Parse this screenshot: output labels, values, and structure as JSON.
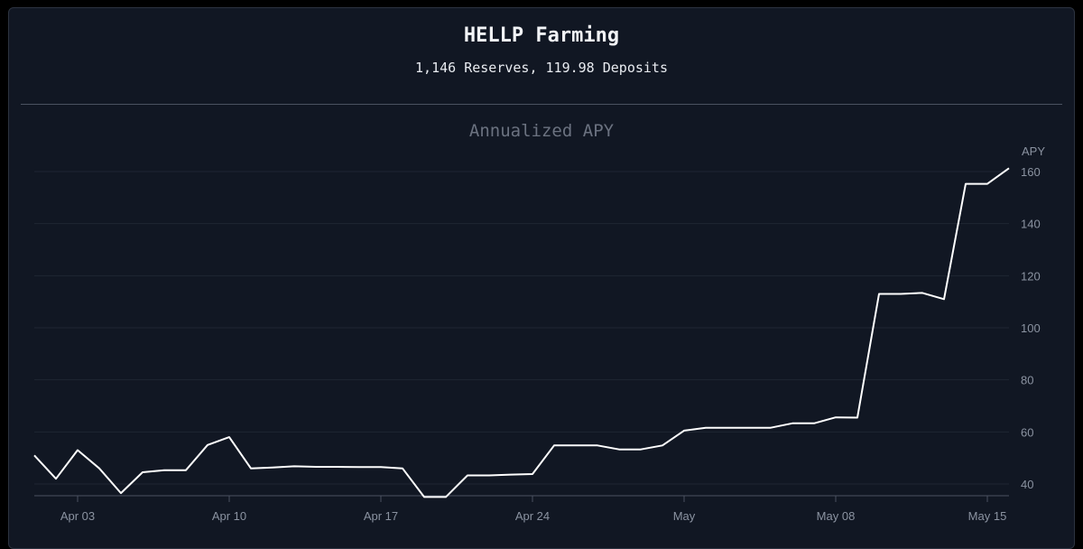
{
  "header": {
    "title": "HELLP Farming",
    "subtitle": "1,146 Reserves, 119.98 Deposits"
  },
  "chart_data": {
    "type": "line",
    "title": "Annualized APY",
    "ylabel": "APY",
    "xlabel": "",
    "ylim": [
      35,
      162
    ],
    "y_ticks": [
      40,
      60,
      80,
      100,
      120,
      140,
      160
    ],
    "x_ticks": [
      {
        "label": "Apr 03",
        "date": "2023-04-03"
      },
      {
        "label": "Apr 10",
        "date": "2023-04-10"
      },
      {
        "label": "Apr 17",
        "date": "2023-04-17"
      },
      {
        "label": "Apr 24",
        "date": "2023-04-24"
      },
      {
        "label": "May",
        "date": "2023-05-01"
      },
      {
        "label": "May 08",
        "date": "2023-05-08"
      },
      {
        "label": "May 15",
        "date": "2023-05-15"
      }
    ],
    "grid": true,
    "line_color": "#ffffff",
    "series": [
      {
        "points": [
          [
            "2023-04-01",
            51
          ],
          [
            "2023-04-02",
            42
          ],
          [
            "2023-04-03",
            53
          ],
          [
            "2023-04-04",
            46
          ],
          [
            "2023-04-05",
            36.5
          ],
          [
            "2023-04-06",
            44.5
          ],
          [
            "2023-04-07",
            45.3
          ],
          [
            "2023-04-08",
            45.3
          ],
          [
            "2023-04-09",
            55
          ],
          [
            "2023-04-10",
            58
          ],
          [
            "2023-04-11",
            46
          ],
          [
            "2023-04-12",
            46.3
          ],
          [
            "2023-04-13",
            46.8
          ],
          [
            "2023-04-14",
            46.6
          ],
          [
            "2023-04-15",
            46.6
          ],
          [
            "2023-04-16",
            46.5
          ],
          [
            "2023-04-17",
            46.5
          ],
          [
            "2023-04-18",
            46
          ],
          [
            "2023-04-19",
            35
          ],
          [
            "2023-04-20",
            35
          ],
          [
            "2023-04-21",
            43.3
          ],
          [
            "2023-04-22",
            43.3
          ],
          [
            "2023-04-23",
            43.6
          ],
          [
            "2023-04-24",
            43.8
          ],
          [
            "2023-04-25",
            54.8
          ],
          [
            "2023-04-26",
            54.8
          ],
          [
            "2023-04-27",
            54.8
          ],
          [
            "2023-04-28",
            53.3
          ],
          [
            "2023-04-29",
            53.3
          ],
          [
            "2023-04-30",
            54.8
          ],
          [
            "2023-05-01",
            60.5
          ],
          [
            "2023-05-02",
            61.6
          ],
          [
            "2023-05-03",
            61.6
          ],
          [
            "2023-05-04",
            61.6
          ],
          [
            "2023-05-05",
            61.6
          ],
          [
            "2023-05-06",
            63.3
          ],
          [
            "2023-05-07",
            63.3
          ],
          [
            "2023-05-08",
            65.6
          ],
          [
            "2023-05-09",
            65.5
          ],
          [
            "2023-05-10",
            113
          ],
          [
            "2023-05-11",
            113
          ],
          [
            "2023-05-12",
            113.4
          ],
          [
            "2023-05-13",
            111
          ],
          [
            "2023-05-14",
            155.3
          ],
          [
            "2023-05-15",
            155.3
          ],
          [
            "2023-05-16",
            161.3
          ]
        ]
      }
    ]
  }
}
